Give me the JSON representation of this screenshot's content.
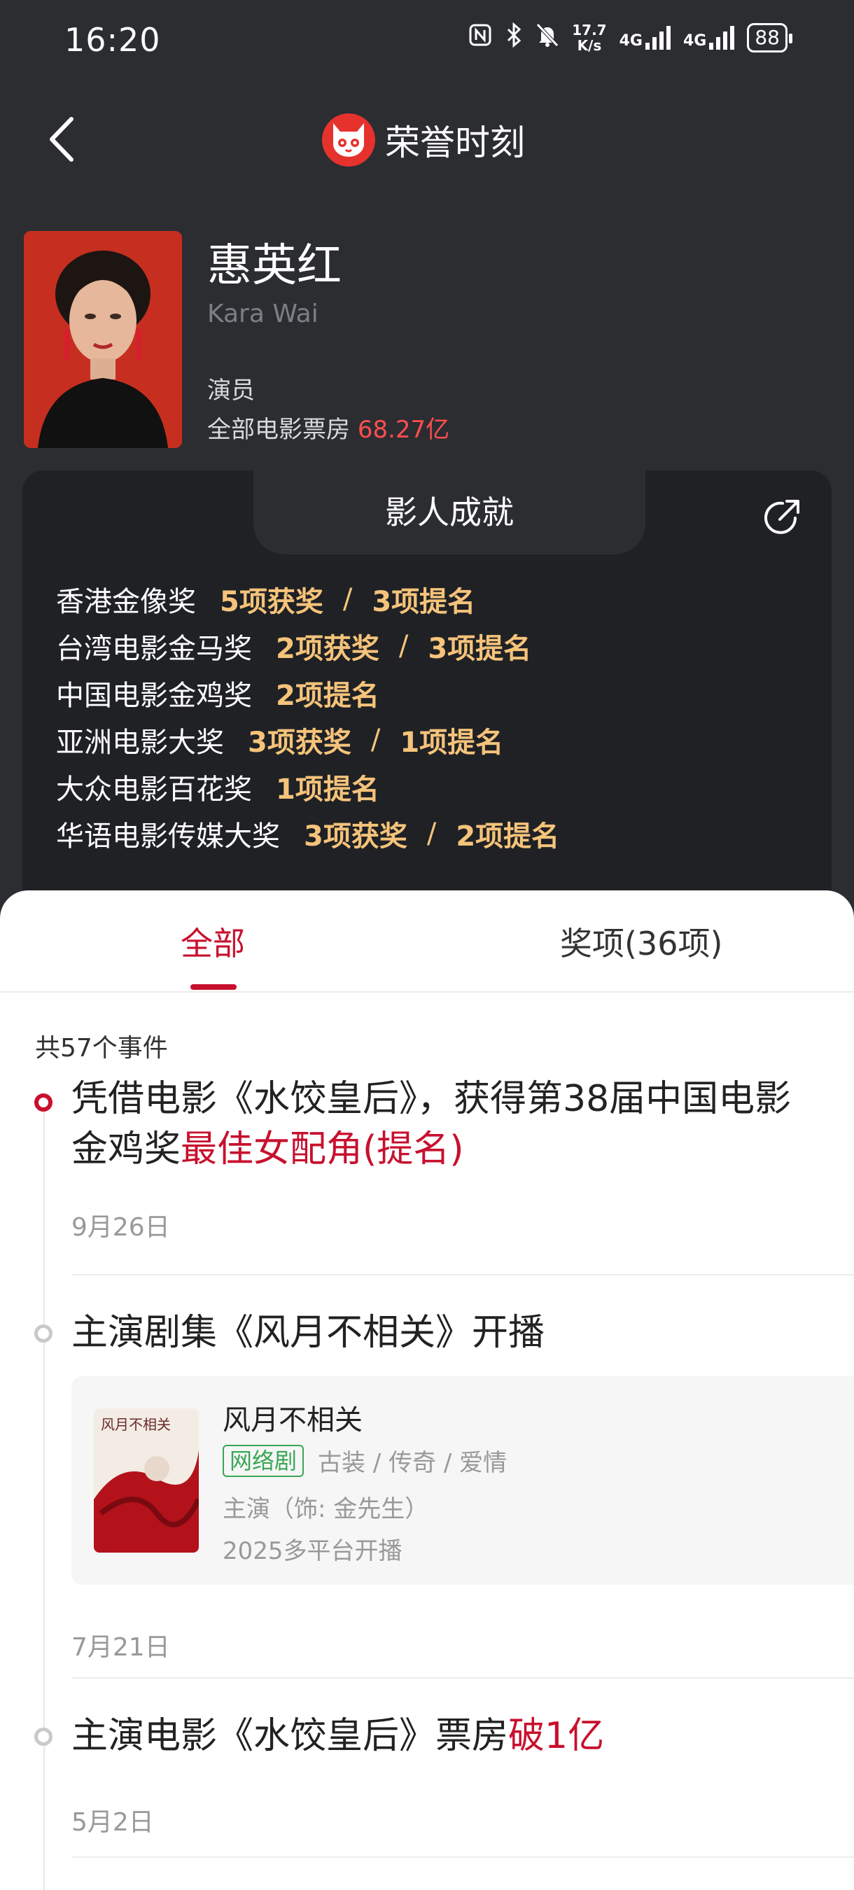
{
  "status_bar": {
    "time": "16:20",
    "network_speed": "17.7\nK/s",
    "signal1": "4G",
    "signal2": "4G",
    "battery": "88"
  },
  "nav": {
    "title": "荣誉时刻"
  },
  "profile": {
    "name": "惠英红",
    "english_name": "Kara Wai",
    "role": "演员",
    "box_office_label": "全部电影票房",
    "box_office_value": "68.27亿"
  },
  "achievements": {
    "title": "影人成就",
    "items": [
      {
        "award": "香港金像奖",
        "wins": "5项获奖",
        "sep": "/",
        "noms": "3项提名"
      },
      {
        "award": "台湾电影金马奖",
        "wins": "2项获奖",
        "sep": "/",
        "noms": "3项提名"
      },
      {
        "award": "中国电影金鸡奖",
        "wins": "",
        "sep": "",
        "noms": "2项提名"
      },
      {
        "award": "亚洲电影大奖",
        "wins": "3项获奖",
        "sep": "/",
        "noms": "1项提名"
      },
      {
        "award": "大众电影百花奖",
        "wins": "",
        "sep": "",
        "noms": "1项提名"
      },
      {
        "award": "华语电影传媒大奖",
        "wins": "3项获奖",
        "sep": "/",
        "noms": "2项提名"
      }
    ]
  },
  "tabs": {
    "all": "全部",
    "awards": "奖项(36项)"
  },
  "events_count": "共57个事件",
  "events": [
    {
      "title_prefix": "凭借电影《水饺皇后》，获得第38届中国电影金鸡奖",
      "title_highlight": "最佳女配角(提名)",
      "date": "9月26日"
    },
    {
      "title_prefix": "主演剧集《风月不相关》开播",
      "title_highlight": "",
      "date": "7月21日",
      "card": {
        "title": "风月不相关",
        "badge": "网络剧",
        "genres": "古装 / 传奇 / 爱情",
        "role": "主演（饰: 金先生）",
        "release": "2025多平台开播",
        "poster_text": "风月不相关"
      }
    },
    {
      "title_prefix": "主演电影《水饺皇后》票房",
      "title_highlight": "破1亿",
      "date": "5月2日"
    }
  ],
  "colors": {
    "accent": "#c8102e",
    "gold": "#f5c37a",
    "box_office_red": "#ff4d4f",
    "badge_green": "#3aa655"
  }
}
